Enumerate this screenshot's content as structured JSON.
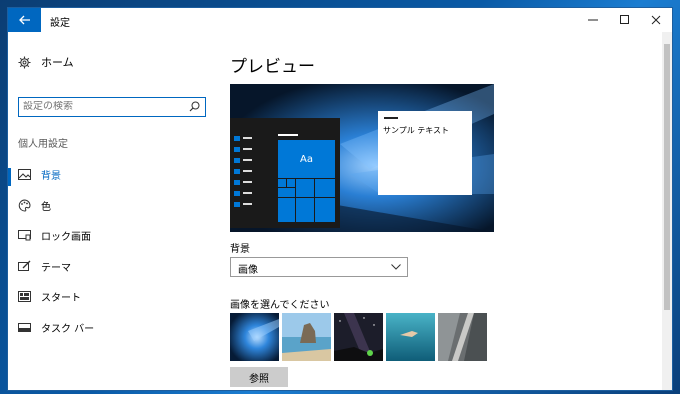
{
  "window": {
    "title": "設定"
  },
  "sidebar": {
    "home": "ホーム",
    "search_placeholder": "設定の検索",
    "section": "個人用設定",
    "items": [
      {
        "label": "背景",
        "icon": "picture-icon",
        "active": true
      },
      {
        "label": "色",
        "icon": "palette-icon",
        "active": false
      },
      {
        "label": "ロック画面",
        "icon": "lock-screen-icon",
        "active": false
      },
      {
        "label": "テーマ",
        "icon": "theme-icon",
        "active": false
      },
      {
        "label": "スタート",
        "icon": "start-icon",
        "active": false
      },
      {
        "label": "タスク バー",
        "icon": "taskbar-icon",
        "active": false
      }
    ]
  },
  "main": {
    "heading": "プレビュー",
    "preview": {
      "tile_label": "Aa",
      "sample_text": "サンプル テキスト"
    },
    "background_label": "背景",
    "background_value": "画像",
    "choose_label": "画像を選んでください",
    "thumbnails": [
      "windows-hero",
      "beach-rocks",
      "starry-night",
      "underwater-swimmer",
      "cliff-road"
    ],
    "browse_label": "参照"
  },
  "colors": {
    "accent": "#0067c0",
    "tile_blue": "#0078d7"
  }
}
